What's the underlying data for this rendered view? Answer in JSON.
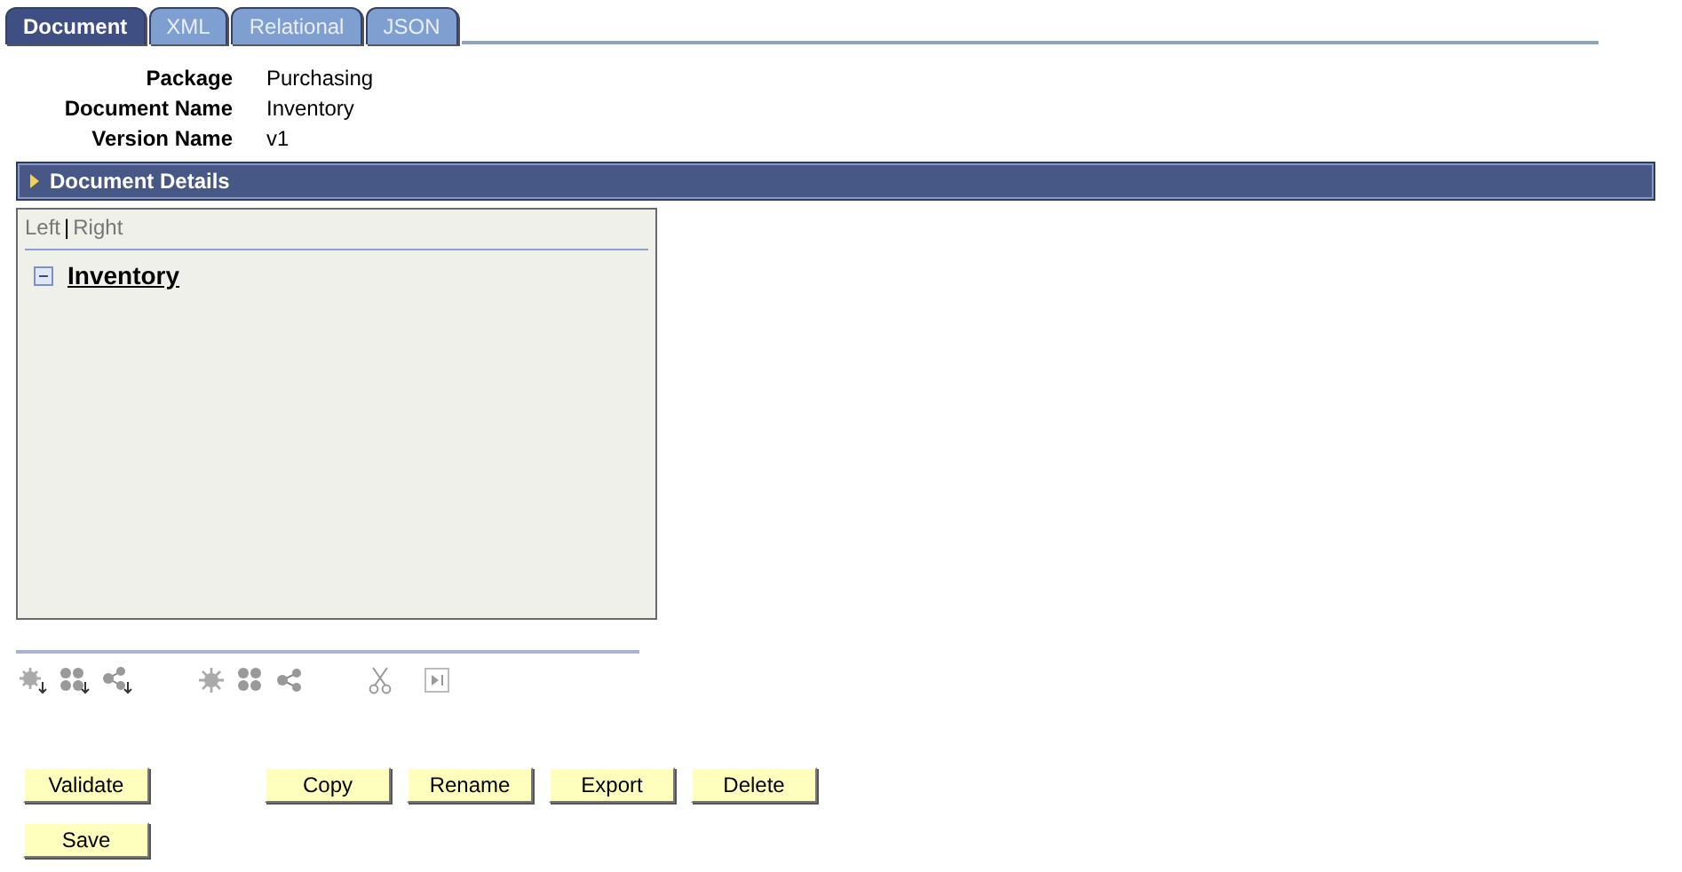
{
  "tabs": [
    {
      "label": "Document",
      "selected": true
    },
    {
      "label": "XML",
      "selected": false
    },
    {
      "label": "Relational",
      "selected": false
    },
    {
      "label": "JSON",
      "selected": false
    }
  ],
  "fields": [
    {
      "label": "Package",
      "value": "Purchasing"
    },
    {
      "label": "Document Name",
      "value": "Inventory"
    },
    {
      "label": "Version Name",
      "value": "v1"
    }
  ],
  "section": {
    "title": "Document Details",
    "expanded": false
  },
  "tree": {
    "view_links": [
      "Left",
      "Right"
    ],
    "separator": "|",
    "root": {
      "label": "Inventory",
      "expanded": true
    }
  },
  "buttons": [
    [
      "Validate",
      "Copy",
      "Rename",
      "Export",
      "Delete"
    ],
    [
      "Save"
    ]
  ]
}
